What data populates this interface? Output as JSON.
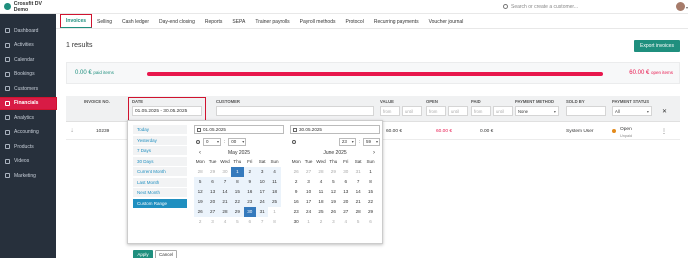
{
  "app": {
    "name": "Crossfit DV Demo"
  },
  "sidebar": {
    "items": [
      {
        "label": "Dashboard",
        "icon": "dashboard-icon",
        "active": false
      },
      {
        "label": "Activities",
        "icon": "activities-icon",
        "active": false
      },
      {
        "label": "Calendar",
        "icon": "calendar-icon",
        "active": false
      },
      {
        "label": "Bookings",
        "icon": "bookings-icon",
        "active": false
      },
      {
        "label": "Customers",
        "icon": "customers-icon",
        "active": false
      },
      {
        "label": "Financials",
        "icon": "financials-icon",
        "active": true
      },
      {
        "label": "Analytics",
        "icon": "analytics-icon",
        "active": false
      },
      {
        "label": "Accounting",
        "icon": "accounting-icon",
        "active": false
      },
      {
        "label": "Products",
        "icon": "products-icon",
        "active": false
      },
      {
        "label": "Videos",
        "icon": "videos-icon",
        "active": false
      },
      {
        "label": "Marketing",
        "icon": "marketing-icon",
        "active": false
      }
    ]
  },
  "topbar": {
    "search_placeholder": "Search or create a customer..."
  },
  "tabs": [
    "Invoices",
    "Selling",
    "Cash ledger",
    "Day-end closing",
    "Reports",
    "SEPA",
    "Trainer payrolls",
    "Payroll methods",
    "Protocol",
    "Recurring payments",
    "Voucher journal"
  ],
  "results_label": "1 results",
  "export_label": "Export invoices",
  "summary": {
    "paid_amount": "0.00 €",
    "paid_label": "paid items",
    "open_amount": "60.00 €",
    "open_label": "open items"
  },
  "table": {
    "headers": {
      "invoice_no": "INVOICE NO.",
      "date": "DATE",
      "customer": "CUSTOMER",
      "value": "VALUE",
      "open": "OPEN",
      "paid": "PAID",
      "payment_method": "PAYMENT METHOD",
      "sold_by": "SOLD BY",
      "payment_status": "PAYMENT STATUS"
    },
    "filters": {
      "date_value": "01.05.2025 - 30.05.2025",
      "from": "from",
      "until": "until",
      "payment_method": "None",
      "payment_status": "All"
    },
    "row": {
      "invoice_no": "10239",
      "value": "60.00 €",
      "open": "60.00 €",
      "paid": "0.00 €",
      "sold_by": "System User",
      "status": "Open",
      "status_sub": "Unpaid"
    }
  },
  "picker": {
    "ranges": [
      "Today",
      "Yesterday",
      "7 Days",
      "30 Days",
      "Current Month",
      "Last Month",
      "Next Month",
      "Custom Range"
    ],
    "active_range": "Custom Range",
    "apply_label": "Apply",
    "cancel_label": "Cancel",
    "start": {
      "date": "01.05.2025",
      "hour": "0",
      "minute": "00",
      "month": "May 2025"
    },
    "end": {
      "date": "30.05.2025",
      "hour": "23",
      "minute": "59",
      "month": "June 2025"
    },
    "dow": [
      "Mon",
      "Tue",
      "Wed",
      "Thu",
      "Fri",
      "Sat",
      "Sun"
    ],
    "left_weeks": [
      [
        "28",
        "29",
        "30",
        "1",
        "2",
        "3",
        "4"
      ],
      [
        "5",
        "6",
        "7",
        "8",
        "9",
        "10",
        "11"
      ],
      [
        "12",
        "13",
        "14",
        "15",
        "16",
        "17",
        "18"
      ],
      [
        "19",
        "20",
        "21",
        "22",
        "23",
        "24",
        "25"
      ],
      [
        "26",
        "27",
        "28",
        "29",
        "30",
        "31",
        "1"
      ],
      [
        "2",
        "3",
        "4",
        "5",
        "6",
        "7",
        "8"
      ]
    ],
    "right_weeks": [
      [
        "26",
        "27",
        "28",
        "29",
        "30",
        "31",
        "1"
      ],
      [
        "2",
        "3",
        "4",
        "5",
        "6",
        "7",
        "8"
      ],
      [
        "9",
        "10",
        "11",
        "12",
        "13",
        "14",
        "15"
      ],
      [
        "16",
        "17",
        "18",
        "19",
        "20",
        "21",
        "22"
      ],
      [
        "23",
        "24",
        "25",
        "26",
        "27",
        "28",
        "29"
      ],
      [
        "30",
        "1",
        "2",
        "3",
        "4",
        "5",
        "6"
      ]
    ]
  },
  "colors": {
    "accent": "#1f8f7e",
    "danger": "#e8174d",
    "highlight": "#d0132f",
    "sidebar_bg": "#27303c",
    "calendar_select": "#357abd"
  }
}
